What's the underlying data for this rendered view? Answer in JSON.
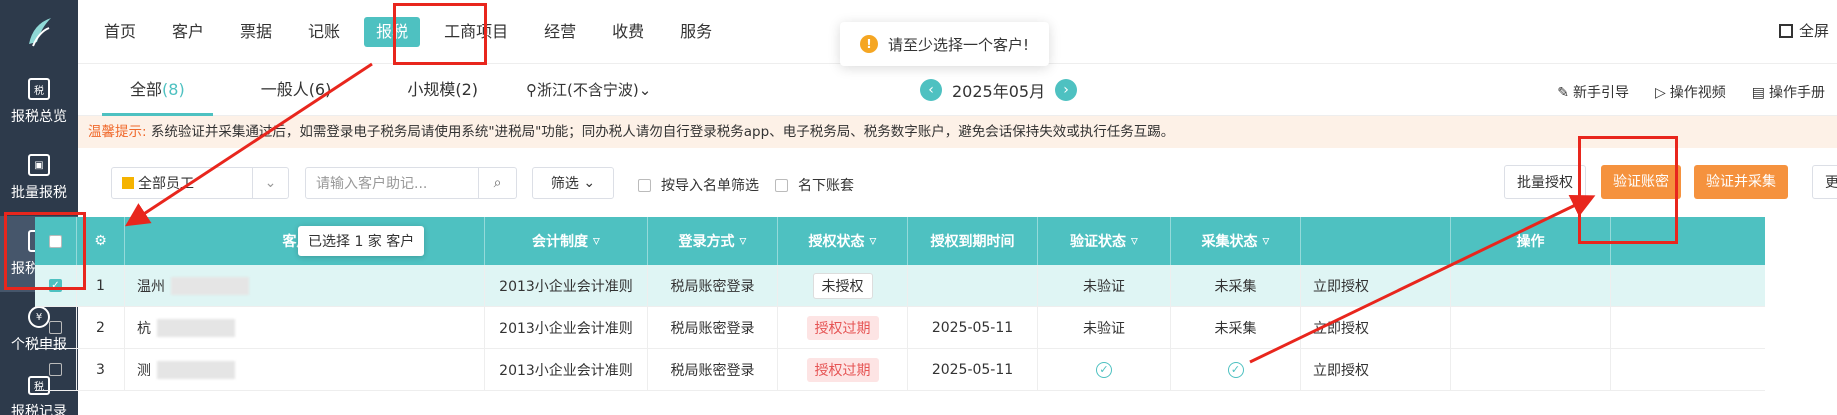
{
  "sidebar": {
    "items": [
      {
        "label": "报税总览",
        "icon": "税"
      },
      {
        "label": "批量报税",
        "icon": "▣"
      },
      {
        "label": "报税设置",
        "icon": "⚙"
      },
      {
        "label": "个税申报",
        "icon": "¥"
      },
      {
        "label": "报税记录",
        "icon": "税"
      }
    ]
  },
  "nav": {
    "items": [
      "首页",
      "客户",
      "票据",
      "记账",
      "报税",
      "工商项目",
      "经营",
      "收费",
      "服务"
    ],
    "fullscreen": "全屏"
  },
  "tabs": {
    "all": "全部",
    "all_count": "(8)",
    "general": "一般人(6)",
    "small": "小规模(2)",
    "region": "浙江(不含宁波)"
  },
  "month": "2025年05月",
  "help": [
    "新手引导",
    "操作视频",
    "操作手册"
  ],
  "notice": {
    "tip_label": "温馨提示:",
    "text": "系统验证并采集通过后，如需登录电子税务局请使用系统\"进税局\"功能；同办税人请勿自行登录税务app、电子税务局、税务数字账户，避免会话保持失效或执行任务互踢。"
  },
  "toolbar": {
    "staff": "全部员工",
    "search_placeholder": "请输入客户助记...",
    "filter": "筛选",
    "import_filter": "按导入名单筛选",
    "my_accounts": "名下账套",
    "batch_auth": "批量授权",
    "verify_pwd": "验证账密",
    "verify_collect": "验证并采集",
    "more": "更"
  },
  "table": {
    "headers": [
      "客户名称",
      "会计制度",
      "登录方式",
      "授权状态",
      "授权到期时间",
      "验证状态",
      "采集状态",
      "操作"
    ],
    "rows": [
      {
        "no": "1",
        "name": "温州",
        "system": "2013小企业会计准则",
        "login": "税局账密登录",
        "auth": "未授权",
        "expire": "",
        "verify": "未验证",
        "collect": "未采集",
        "op": "立即授权"
      },
      {
        "no": "2",
        "name": "杭",
        "system": "2013小企业会计准则",
        "login": "税局账密登录",
        "auth": "授权过期",
        "expire": "2025-05-11",
        "verify": "未验证",
        "collect": "未采集",
        "op": "立即授权"
      },
      {
        "no": "3",
        "name": "测",
        "system": "2013小企业会计准则",
        "login": "税局账密登录",
        "auth": "授权过期",
        "expire": "2025-05-11",
        "verify": "✓",
        "collect": "✓",
        "op": "立即授权"
      }
    ]
  },
  "toast": "请至少选择一个客户!",
  "tooltip": "已选择 1 家 客户",
  "colors": {
    "accent": "#4ec1c1",
    "sidebar": "#2d3a4b",
    "orange": "#f5923e",
    "annotation": "#e8261d"
  }
}
